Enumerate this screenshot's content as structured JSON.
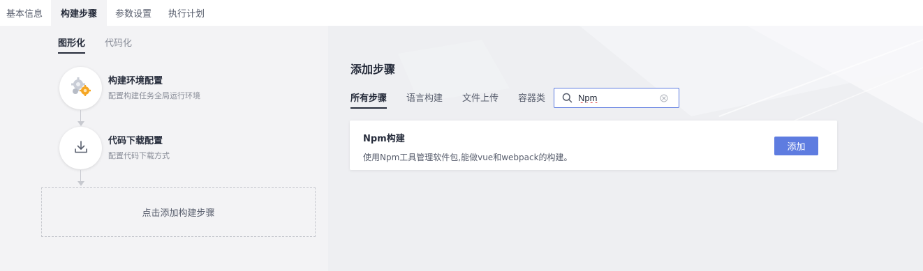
{
  "top_tabs": [
    {
      "label": "基本信息"
    },
    {
      "label": "构建步骤"
    },
    {
      "label": "参数设置"
    },
    {
      "label": "执行计划"
    }
  ],
  "active_top_tab": "构建步骤",
  "left": {
    "view_tabs": [
      {
        "label": "图形化"
      },
      {
        "label": "代码化"
      }
    ],
    "steps": [
      {
        "title": "构建环境配置",
        "desc": "配置构建任务全局运行环境",
        "icon": "gear-cluster-icon"
      },
      {
        "title": "代码下载配置",
        "desc": "配置代码下载方式",
        "icon": "download-icon"
      }
    ],
    "add_step_label": "点击添加构建步骤"
  },
  "right": {
    "title": "添加步骤",
    "category_tabs": [
      {
        "label": "所有步骤"
      },
      {
        "label": "语言构建"
      },
      {
        "label": "文件上传"
      },
      {
        "label": "容器类"
      }
    ],
    "search": {
      "value": "Npm",
      "placeholder": ""
    },
    "results": [
      {
        "title": "Npm构建",
        "desc": "使用Npm工具管理软件包,能做vue和webpack的构建。",
        "button_label": "添加"
      }
    ]
  },
  "colors": {
    "accent": "#5e7ce0",
    "text_primary": "#252b3a",
    "text_secondary": "#575d6c",
    "muted": "#8a8e99"
  }
}
